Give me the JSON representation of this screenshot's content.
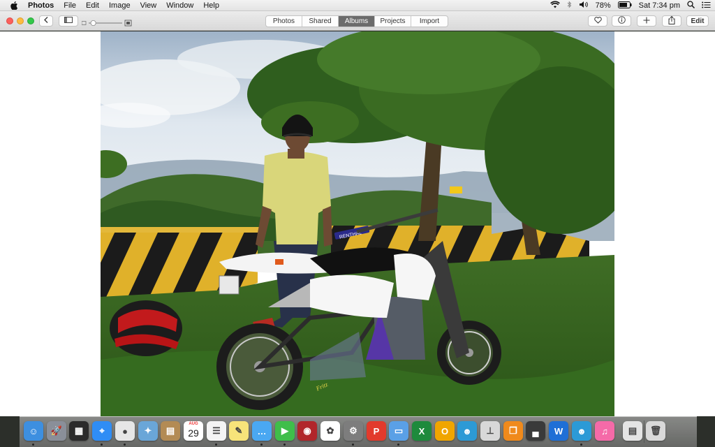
{
  "menubar": {
    "app_name": "Photos",
    "items": [
      "File",
      "Edit",
      "Image",
      "View",
      "Window",
      "Help"
    ],
    "battery": "78%",
    "clock": "Sat 7:34 pm"
  },
  "toolbar": {
    "tabs": [
      {
        "label": "Photos",
        "active": false
      },
      {
        "label": "Shared",
        "active": false
      },
      {
        "label": "Albums",
        "active": true
      },
      {
        "label": "Projects",
        "active": false
      },
      {
        "label": "Import",
        "active": false
      }
    ],
    "edit_label": "Edit",
    "zoom_level": 0.1
  },
  "photo": {
    "plate_text": "",
    "handlebar_brand": "RENTHAL"
  },
  "dock": {
    "calendar_month": "AUG",
    "calendar_day": "29",
    "items": [
      {
        "name": "finder-icon",
        "color": "#3d8fe0",
        "glyph": "☺"
      },
      {
        "name": "launchpad-icon",
        "color": "#8a8f99",
        "glyph": "🚀"
      },
      {
        "name": "mission-control-icon",
        "color": "#2b2b2b",
        "glyph": "▦"
      },
      {
        "name": "safari-icon",
        "color": "#2f8df5",
        "glyph": "⌖"
      },
      {
        "name": "chrome-icon",
        "color": "#e6e6e6",
        "glyph": "●"
      },
      {
        "name": "preview-icon",
        "color": "#6aa6d8",
        "glyph": "✦"
      },
      {
        "name": "contacts-icon",
        "color": "#b38b54",
        "glyph": "▤"
      },
      {
        "name": "calendar-icon",
        "color": "#ffffff",
        "glyph": ""
      },
      {
        "name": "reminders-icon",
        "color": "#f4f4f4",
        "glyph": "☰"
      },
      {
        "name": "notes-icon",
        "color": "#f7e37a",
        "glyph": "✎"
      },
      {
        "name": "messages-icon",
        "color": "#4aa8f2",
        "glyph": "…"
      },
      {
        "name": "facetime-icon",
        "color": "#3fbe4a",
        "glyph": "▶"
      },
      {
        "name": "photo-booth-icon",
        "color": "#b1262a",
        "glyph": "◉"
      },
      {
        "name": "photos-icon",
        "color": "#ffffff",
        "glyph": "✿"
      },
      {
        "name": "system-preferences-icon",
        "color": "#7d7d7d",
        "glyph": "⚙"
      },
      {
        "name": "wps-icon",
        "color": "#e23a2c",
        "glyph": "P"
      },
      {
        "name": "keynote-icon",
        "color": "#5aa0e6",
        "glyph": "▭"
      },
      {
        "name": "excel-icon",
        "color": "#1e8a3c",
        "glyph": "X"
      },
      {
        "name": "outlook-icon",
        "color": "#f0a500",
        "glyph": "O"
      },
      {
        "name": "lync-icon",
        "color": "#2c9ad6",
        "glyph": "☻"
      },
      {
        "name": "airport-utility-icon",
        "color": "#d8d8d8",
        "glyph": "⊥"
      },
      {
        "name": "ibooks-icon",
        "color": "#f08a1c",
        "glyph": "❐"
      },
      {
        "name": "printer-icon",
        "color": "#3a3a3a",
        "glyph": "▄"
      },
      {
        "name": "word-icon",
        "color": "#1f6fd6",
        "glyph": "W"
      },
      {
        "name": "messenger-icon",
        "color": "#2c9ad6",
        "glyph": "☻"
      },
      {
        "name": "itunes-icon",
        "color": "#f56aa8",
        "glyph": "♫"
      },
      {
        "name": "documents-folder-icon",
        "color": "#e4e4e4",
        "glyph": "▤"
      },
      {
        "name": "trash-icon",
        "color": "#d9d9d9",
        "glyph": "🗑"
      }
    ]
  }
}
